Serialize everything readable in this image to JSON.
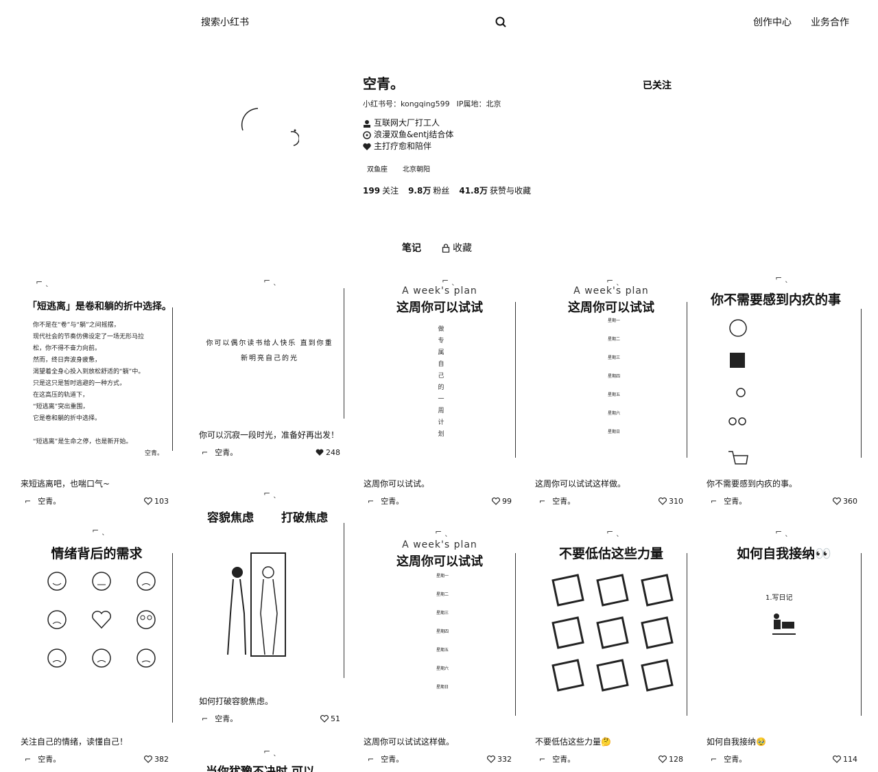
{
  "header": {
    "search_placeholder": "搜索小红书",
    "nav": [
      "创作中心",
      "业务合作"
    ]
  },
  "profile": {
    "name": "空青。",
    "id_label": "小红书号：kongqing599",
    "ip_label": "IP属地：北京",
    "follow_button": "已关注",
    "bio": [
      "互联网大厂打工人",
      "浪漫双鱼&entj结合体",
      "主打疗愈和陪伴"
    ],
    "tags": [
      "双鱼座",
      "北京朝阳"
    ],
    "stats": [
      {
        "num": "199",
        "label": "关注"
      },
      {
        "num": "9.8万",
        "label": "粉丝"
      },
      {
        "num": "41.8万",
        "label": "获赞与收藏"
      }
    ]
  },
  "tabs": [
    "笔记",
    "收藏"
  ],
  "cards": [
    {
      "title": "来短逃离吧，也喘口气~",
      "author": "空青。",
      "likes": "103",
      "cover_heading": "「短逃离」是卷和躺的折中选择。",
      "cover_lines": [
        "你不是在“卷”与“躺”之间摇摆，",
        "现代社会的节奏仿佛设定了一场无形马拉",
        "松，你不得不奋力向前。",
        "然而，终日奔波身疲惫，",
        "渴望着全身心投入到放松舒适的“躺”中。",
        "只是这只是暂时逃避的一种方式，",
        "在这高压的轨道下，",
        "“短逃离”突出重围，",
        "它是卷和躺的折中选择。",
        "",
        "“短逃离”是生命之停，也是新开始。",
        "空青。"
      ]
    },
    {
      "title": "你可以沉寂一段时光，准备好再出发！",
      "author": "空青。",
      "likes": "248",
      "cover_quote": "你可以偶尔读书给人快乐 直到你重新明亮自己的光"
    },
    {
      "title": "这周你可以试试。",
      "author": "空青。",
      "likes": "99",
      "cover_en": "A week's plan",
      "cover_heading": "这周你可以试试",
      "cover_vertical": "做 专 属 自 己 的 一 周 计 划"
    },
    {
      "title": "这周你可以试试这样做。",
      "author": "空青。",
      "likes": "310",
      "cover_en": "A week's plan",
      "cover_heading": "这周你可以试试",
      "cover_days": [
        "星期一",
        "星期二",
        "星期三",
        "星期四",
        "星期五",
        "星期六",
        "星期日"
      ]
    },
    {
      "title": "你不需要感到内疚的事。",
      "author": "空青。",
      "likes": "360",
      "cover_heading": "你不需要感到内疚的事"
    },
    {
      "title": "关注自己的情绪，读懂自己！",
      "author": "空青。",
      "likes": "382",
      "cover_heading": "情绪背后的需求"
    },
    {
      "title": "如何打破容貌焦虑。",
      "author": "空青。",
      "likes": "51",
      "cover_heading_left": "容貌焦虑",
      "cover_heading_right": "打破焦虑"
    },
    {
      "title": "这周你可以试试这样做。",
      "author": "空青。",
      "likes": "332",
      "cover_en": "A week's plan",
      "cover_heading": "这周你可以试试",
      "cover_days": [
        "星期一",
        "星期二",
        "星期三",
        "星期四",
        "星期五",
        "星期六",
        "星期日"
      ]
    },
    {
      "title": "不要低估这些力量🤔",
      "author": "空青。",
      "likes": "128",
      "cover_heading": "不要低估这些力量"
    },
    {
      "title": "如何自我接纳🥹",
      "author": "空青。",
      "likes": "114",
      "cover_heading": "如何自我接纳👀",
      "cover_step": "1.写日记"
    }
  ],
  "partial_card_title": "当你犹豫不决时 可以"
}
